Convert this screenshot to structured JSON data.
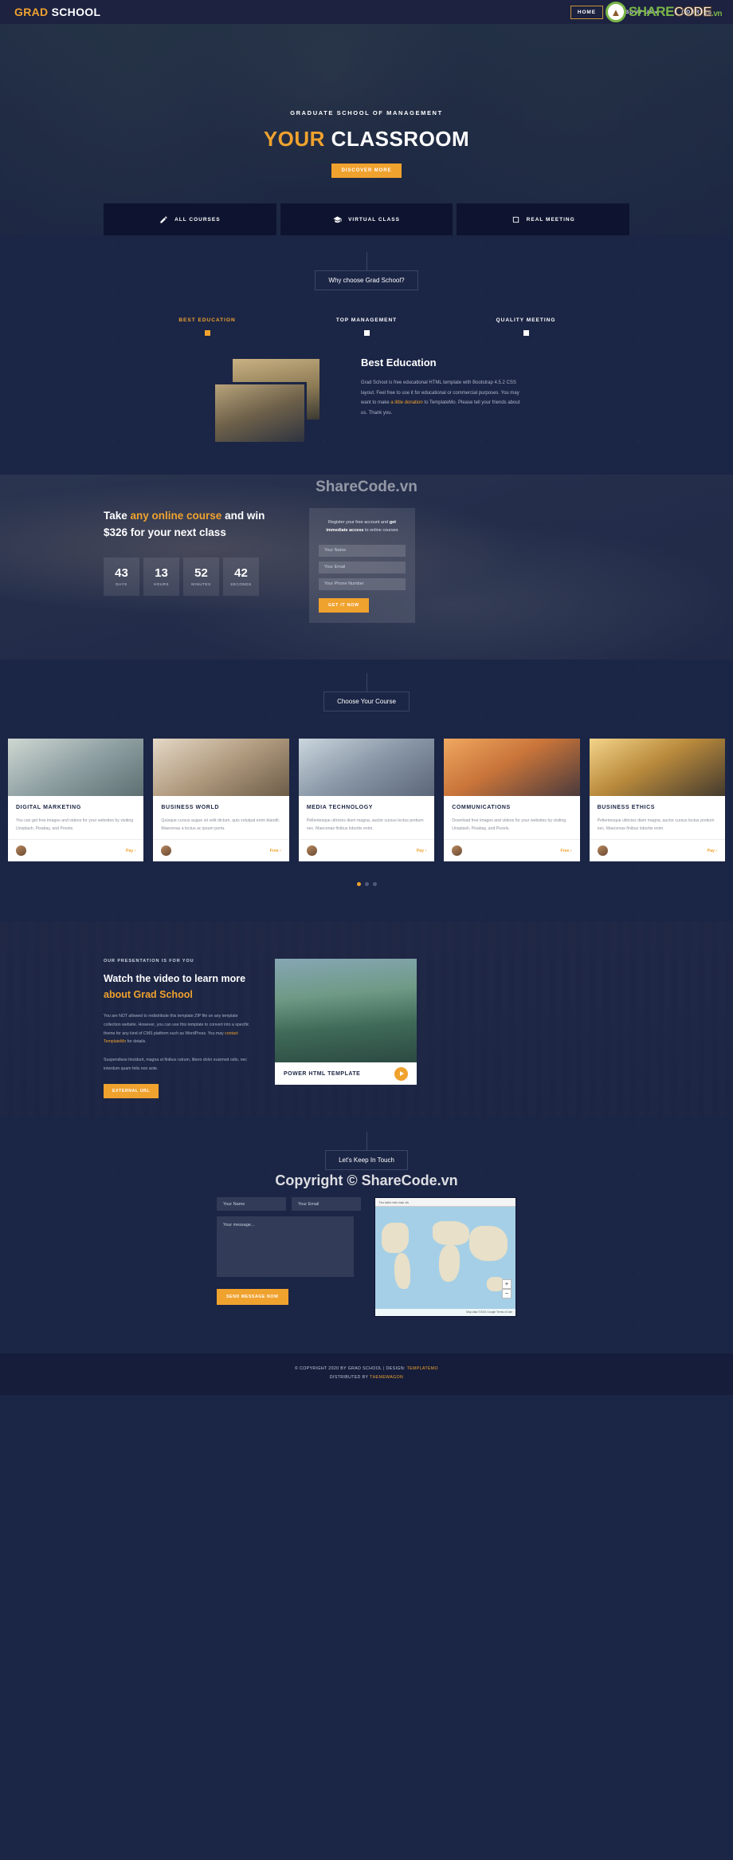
{
  "header": {
    "logo_orange": "GRAD",
    "logo_white": "SCHOOL",
    "nav": [
      {
        "label": "Home",
        "active": true,
        "caret": ""
      },
      {
        "label": "About Us",
        "active": false,
        "caret": "⌄"
      },
      {
        "label": "Courses",
        "active": false,
        "caret": ""
      }
    ]
  },
  "hero": {
    "subtitle": "GRADUATE SCHOOL OF MANAGEMENT",
    "title_highlight": "YOUR",
    "title_rest": "CLASSROOM",
    "button": "DISCOVER MORE",
    "features": [
      {
        "label": "ALL COURSES",
        "icon": "pencil-icon"
      },
      {
        "label": "VIRTUAL CLASS",
        "icon": "graduation-cap-icon"
      },
      {
        "label": "REAL MEETING",
        "icon": "book-icon"
      }
    ]
  },
  "why": {
    "tag": "Why choose Grad School?",
    "tabs": [
      {
        "label": "BEST EDUCATION",
        "active": true
      },
      {
        "label": "TOP MANAGEMENT",
        "active": false
      },
      {
        "label": "QUALITY MEETING",
        "active": false
      }
    ],
    "heading": "Best Education",
    "body_1": "Grad School is free educational HTML template with Bootstrap 4.5.2 CSS layout. Feel free to use it for educational or commercial purposes. You may want to make ",
    "body_link": "a little donation",
    "body_2": " to TemplateMo. Please tell your friends about us. Thank you."
  },
  "countdown": {
    "heading_1": "Take ",
    "heading_hl": "any online course",
    "heading_2": " and win $326 for your next class",
    "units": [
      {
        "num": "43",
        "label": "DAYS"
      },
      {
        "num": "13",
        "label": "HOURS"
      },
      {
        "num": "52",
        "label": "MINUTES"
      },
      {
        "num": "42",
        "label": "SECONDS"
      }
    ],
    "form_text_1": "Register your free account and ",
    "form_text_bold": "get immediate access",
    "form_text_2": " to online courses",
    "name_placeholder": "Your Name",
    "email_placeholder": "Your Email",
    "phone_placeholder": "Your Phone Number",
    "submit": "GET IT NOW"
  },
  "courses": {
    "tag": "Choose Your Course",
    "cards": [
      {
        "title": "DIGITAL MARKETING",
        "desc": "You can get free images and videos for your websites by visiting Unsplash, Pixabay, and Pexels.",
        "price": "Pay ›",
        "img_class": "c1"
      },
      {
        "title": "BUSINESS WORLD",
        "desc": "Quisque cursus augue sit velit dictum, quis volutpat enim blandit. Maecenas a lectus ac ipsum porta.",
        "price": "Free ›",
        "img_class": "c2"
      },
      {
        "title": "MEDIA TECHNOLOGY",
        "desc": "Pellentesque ultricies diam magna, auctor cursus lectus pretium nec. Maecenas finibus lobortis enim.",
        "price": "Pay ›",
        "img_class": "c3"
      },
      {
        "title": "COMMUNICATIONS",
        "desc": "Download free images and videos for your websites by visiting Unsplash, Pixabay, and Pexels.",
        "price": "Free ›",
        "img_class": "c4"
      },
      {
        "title": "BUSINESS ETHICS",
        "desc": "Pellentesque ultricies diam magna, auctor cursus lectus pretium nec. Maecenas finibus lobortis enim.",
        "price": "Pay ›",
        "img_class": "c5"
      }
    ],
    "pagination": [
      {
        "active": true
      },
      {
        "active": false
      },
      {
        "active": false
      }
    ]
  },
  "video": {
    "eyebrow": "OUR PRESENTATION IS FOR YOU",
    "heading_1": "Watch the video to learn more",
    "heading_hl": "about Grad School",
    "p1_a": "You are NOT allowed to redistribute this template ZIP file on any template collection website. However, you can use this template to convert into a specific theme for any kind of CMS platform such as WordPress. You may ",
    "p1_link": "contact TemplateMo",
    "p1_b": " for details.",
    "p2": "Suspendisse tincidunt, magna ut finibus rutrum, libero dolor euismod odio, nec interdum quam felis non ante.",
    "button": "EXTERNAL URL",
    "bar_label": "POWER HTML TEMPLATE",
    "play_icon": "play-icon"
  },
  "contact": {
    "tag": "Let's Keep In Touch",
    "name_placeholder": "Your Name",
    "email_placeholder": "Your Email",
    "message_placeholder": "Your message...",
    "submit": "SEND MESSAGE NOW",
    "map_search": "Tìm kiếm trên bản đồ",
    "map_attrib": "Map data ©2024  Google  Terms of Use",
    "zoom_in": "+",
    "zoom_out": "−"
  },
  "footer": {
    "line1_a": "© COPYRIGHT 2020 BY GRAD SCHOOL | DESIGN: ",
    "line1_link": "TEMPLATEMO",
    "line2_a": "DISTRIBUTED BY ",
    "line2_link": "THEMEWAGON"
  },
  "watermark": {
    "brand_a": "SHARE",
    "brand_b": "CODE",
    "brand_vn": ".vn",
    "mid": "ShareCode.vn",
    "copyright": "Copyright © ShareCode.vn"
  }
}
